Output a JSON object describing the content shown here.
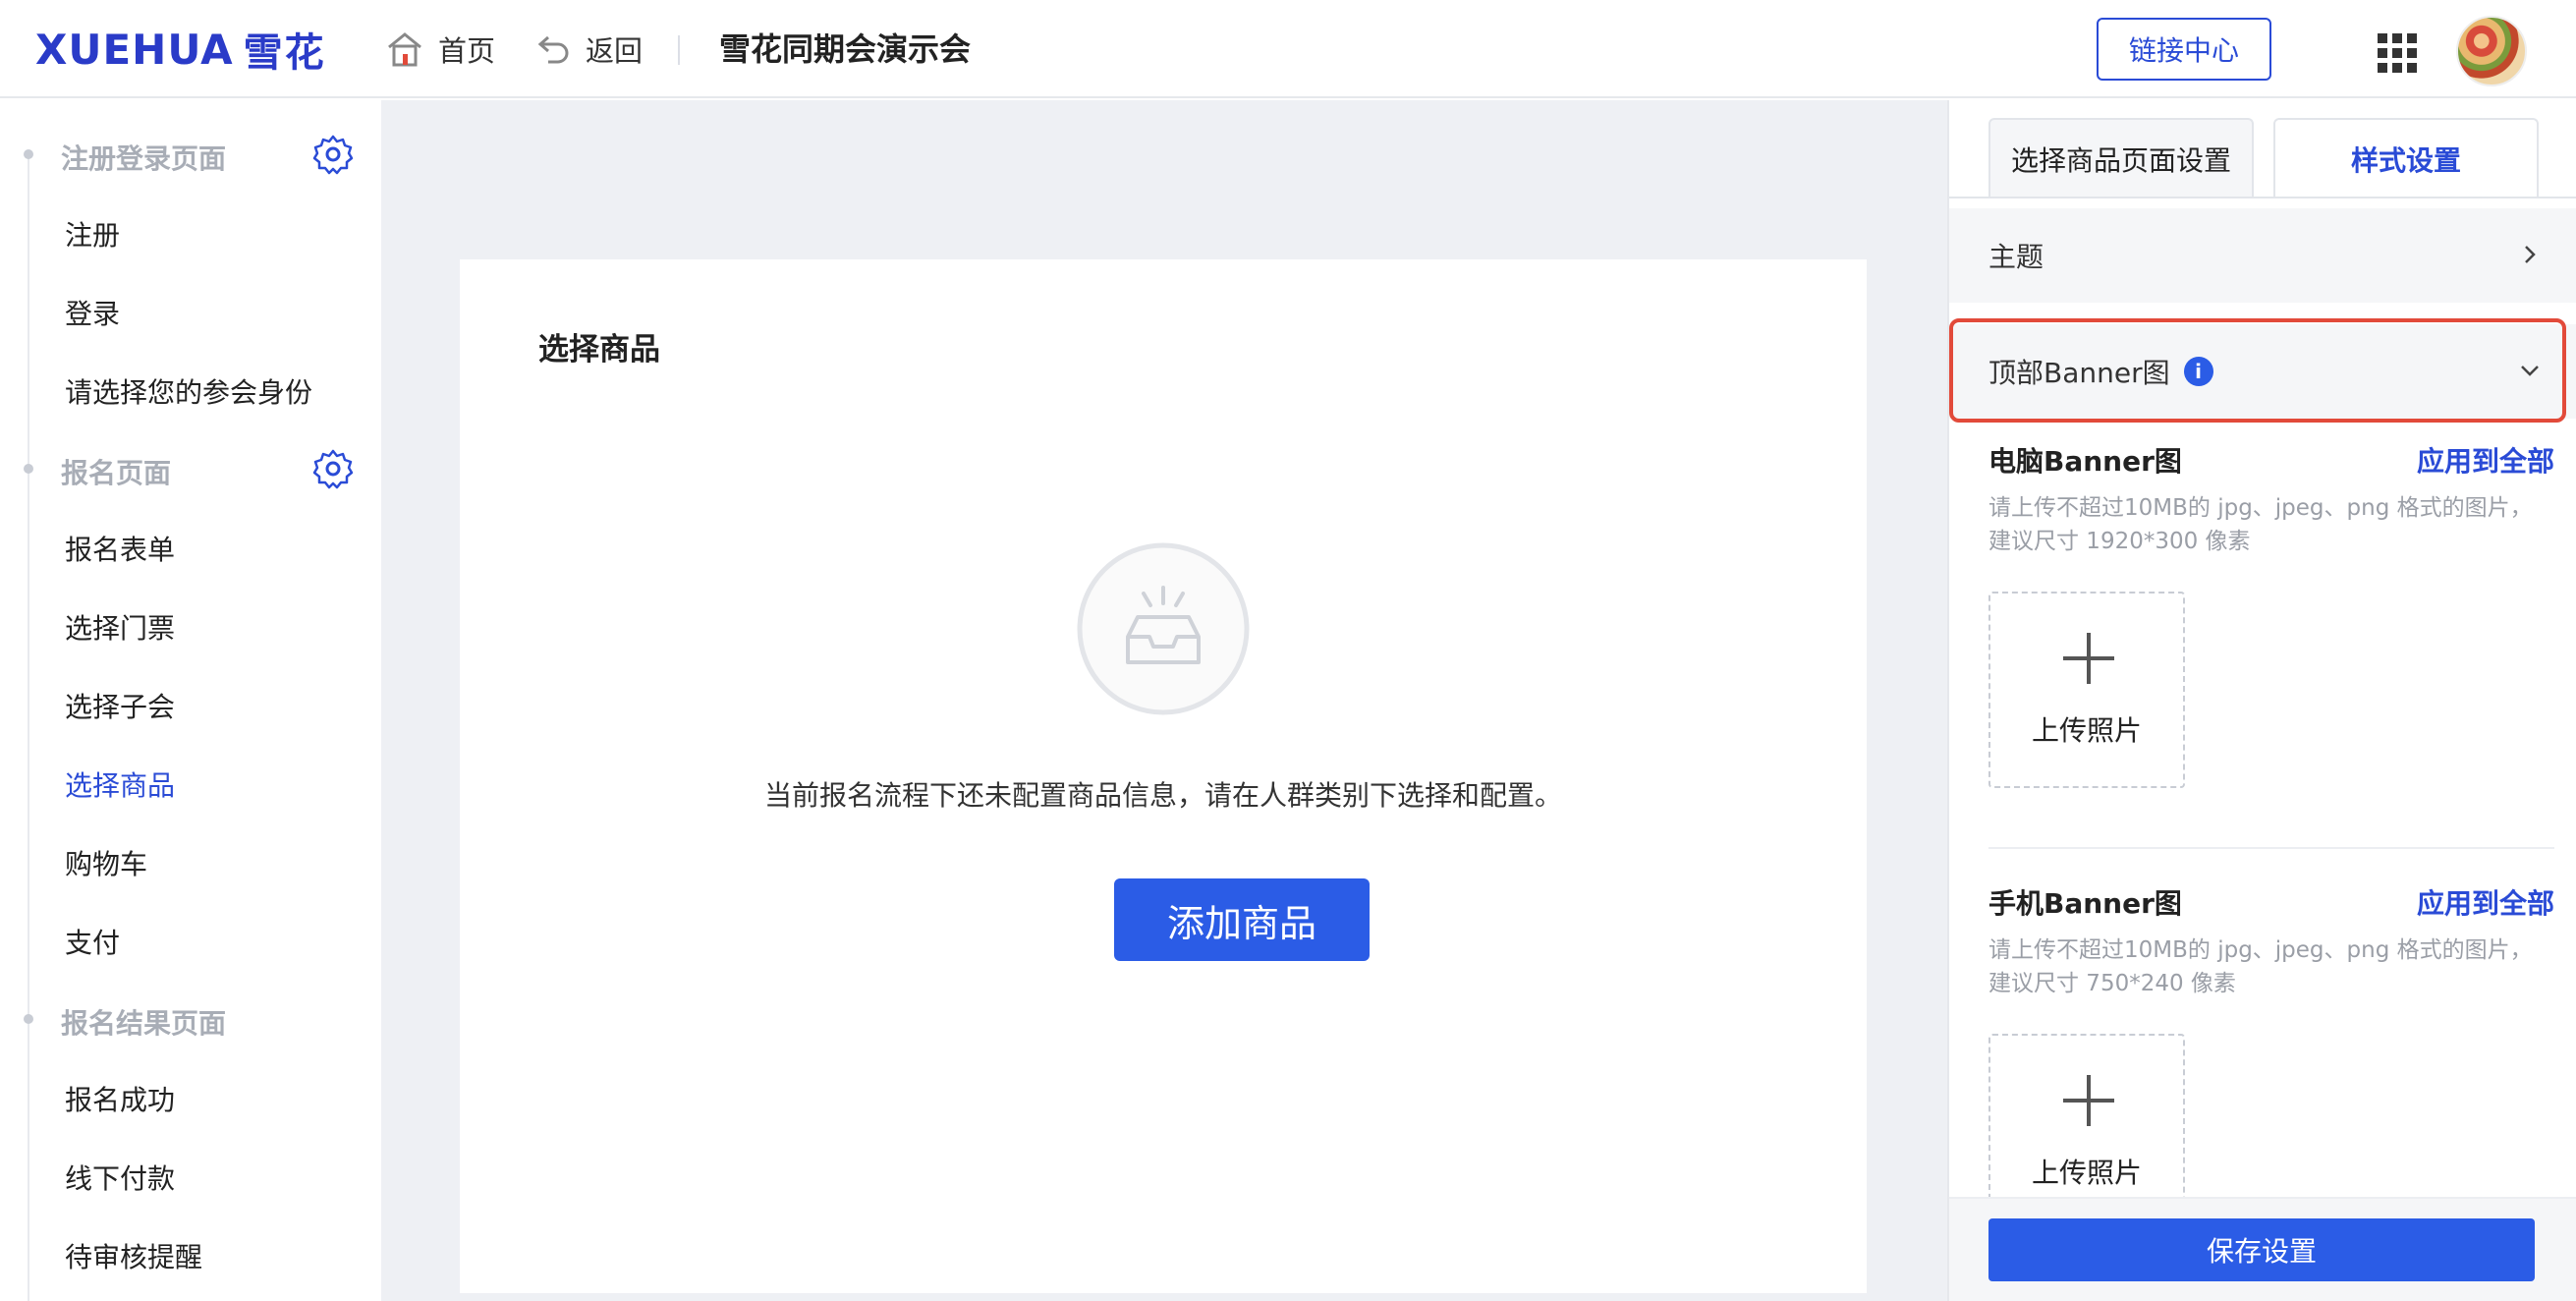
{
  "header": {
    "logo_latin": "XUEHUA",
    "logo_cn": "雪花",
    "home_label": "首页",
    "back_label": "返回",
    "app_title": "雪花同期会演示会",
    "link_center_label": "链接中心"
  },
  "sidebar": {
    "sections": [
      {
        "title": "注册登录页面",
        "items": [
          "注册",
          "登录",
          "请选择您的参会身份"
        ]
      },
      {
        "title": "报名页面",
        "items": [
          "报名表单",
          "选择门票",
          "选择子会",
          "选择商品",
          "购物车",
          "支付"
        ]
      },
      {
        "title": "报名结果页面",
        "items": [
          "报名成功",
          "线下付款",
          "待审核提醒"
        ]
      }
    ],
    "active_item": "选择商品"
  },
  "main": {
    "card_title": "选择商品",
    "empty_text": "当前报名流程下还未配置商品信息，请在人群类别下选择和配置。",
    "add_button_label": "添加商品"
  },
  "panel": {
    "tabs": [
      "选择商品页面设置",
      "样式设置"
    ],
    "active_tab": "样式设置",
    "theme_label": "主题",
    "banner_label": "顶部Banner图",
    "info_glyph": "i",
    "pc": {
      "title": "电脑Banner图",
      "apply_all": "应用到全部",
      "hint": "请上传不超过10MB的 jpg、jpeg、png 格式的图片，建议尺寸 1920*300 像素",
      "upload_label": "上传照片"
    },
    "mobile": {
      "title": "手机Banner图",
      "apply_all": "应用到全部",
      "hint": "请上传不超过10MB的 jpg、jpeg、png 格式的图片，建议尺寸 750*240 像素",
      "upload_label": "上传照片"
    },
    "save_label": "保存设置"
  },
  "colors": {
    "brand": "#2a3bc8",
    "primary": "#2b5ce6",
    "highlight": "#e24a3a",
    "canvas": "#eef0f4"
  },
  "icons": [
    "home-icon",
    "back-arrow-icon",
    "apps-grid-icon",
    "avatar",
    "gear-icon",
    "empty-inbox-icon",
    "chevron-right-icon",
    "chevron-down-icon",
    "info-icon",
    "plus-icon"
  ]
}
